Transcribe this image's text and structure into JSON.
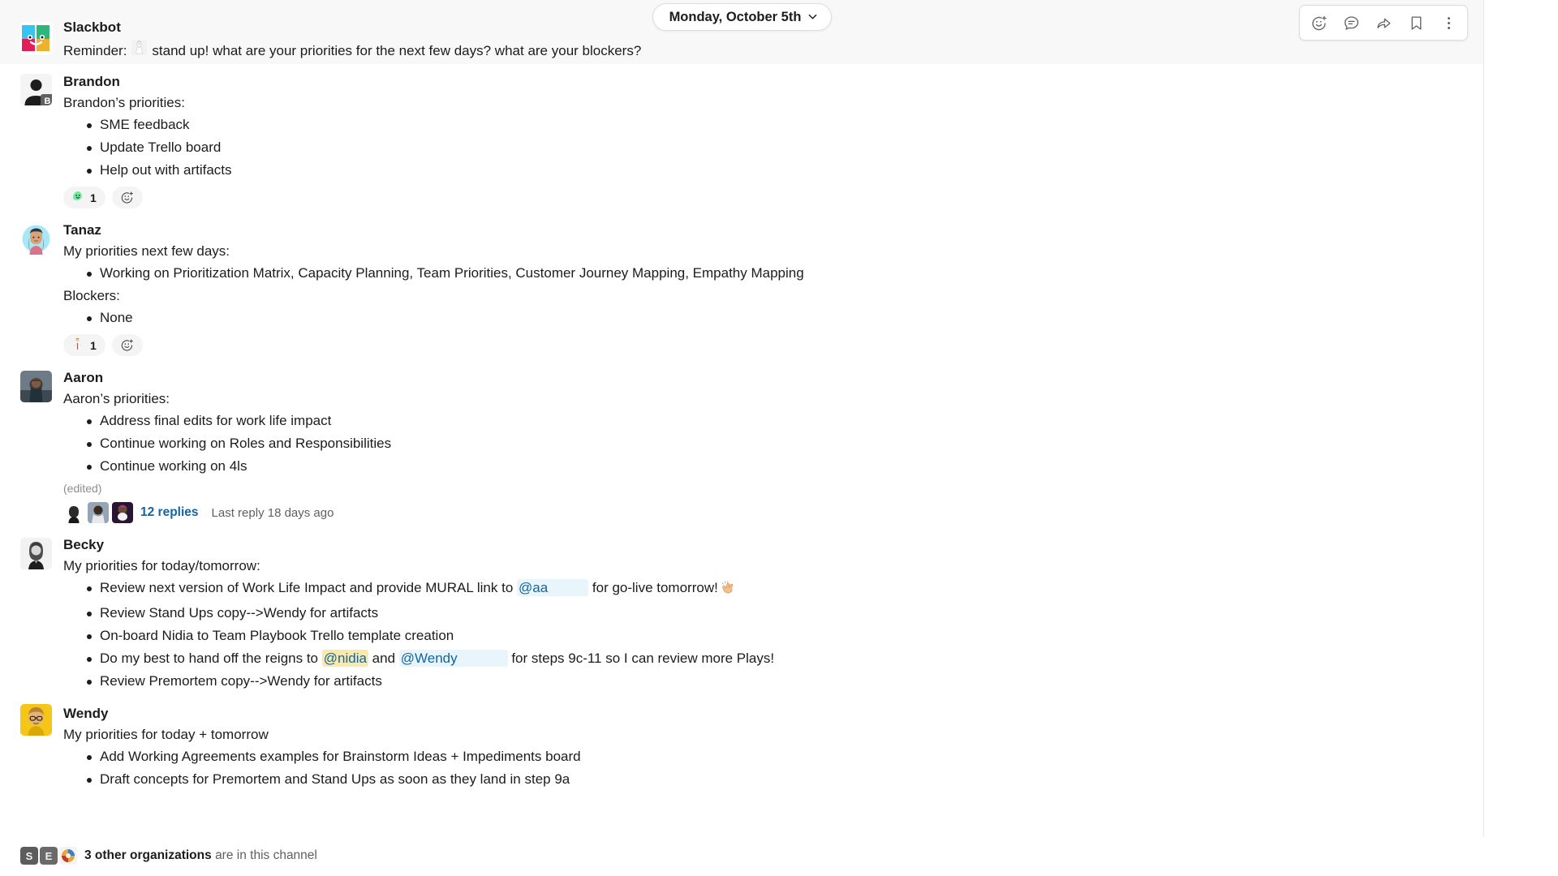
{
  "header": {
    "date_pill_label": "Monday, October 5th",
    "chevron_icon": "chevron-down-icon",
    "toolbar": {
      "add_reaction": "add-reaction-icon",
      "reply_in_thread": "reply-in-thread-icon",
      "forward": "forward-message-icon",
      "save": "bookmark-icon",
      "more": "more-actions-icon"
    }
  },
  "slackbot": {
    "name": "Slackbot",
    "reminder_prefix": "Reminder:",
    "emoji": "standing-person-emoji",
    "reminder_text": "stand up! what are your priorities for the next few days? what are your blockers?"
  },
  "messages": [
    {
      "author": "Brandon",
      "avatar_type": "default-silhouette",
      "badge": "B",
      "intro": "Brandon’s priorities:",
      "bullets": [
        "SME feedback",
        "Update Trello board",
        "Help out with artifacts"
      ],
      "reactions": [
        {
          "emoji": "green-blob-emoji",
          "count": "1"
        }
      ],
      "add_reaction_label": "add-reaction-icon"
    },
    {
      "author": "Tanaz",
      "avatar_type": "illustrated-cyan",
      "intro": "My priorities next few days:",
      "bullets": [
        "Working on Prioritization Matrix, Capacity Planning, Team Priorities, Customer Journey Mapping, Empathy Mapping"
      ],
      "second_intro": "Blockers:",
      "second_bullets": [
        "None"
      ],
      "reactions": [
        {
          "emoji": "person-emoji",
          "count": "1"
        }
      ],
      "add_reaction_label": "add-reaction-icon"
    },
    {
      "author": "Aaron",
      "avatar_type": "photo-dark",
      "intro": "Aaron’s priorities:",
      "bullets": [
        "Address final edits for work life impact",
        "Continue working on Roles and Responsibilities",
        "Continue working on 4ls"
      ],
      "edited_label": "(edited)",
      "thread": {
        "replies_label": "12 replies",
        "last_reply_label": "Last reply 18 days ago",
        "participant_count": 3
      }
    },
    {
      "author": "Becky",
      "avatar_type": "photo-bw",
      "intro": "My priorities for today/tomorrow:",
      "rich_bullets": [
        {
          "parts": [
            {
              "t": "Review next version of Work Life Impact and provide MURAL link to ",
              "k": "text"
            },
            {
              "t": "@aa",
              "k": "mention-blue"
            },
            {
              "t": " for go-live tomorrow!",
              "k": "text"
            },
            {
              "t": "clapping-hands-emoji",
              "k": "emoji"
            }
          ]
        },
        {
          "parts": [
            {
              "t": "Review Stand Ups copy-->Wendy for artifacts",
              "k": "text"
            }
          ]
        },
        {
          "parts": [
            {
              "t": "On-board Nidia to Team Playbook Trello template creation",
              "k": "text"
            }
          ]
        },
        {
          "parts": [
            {
              "t": "Do my best to hand off the reigns to ",
              "k": "text"
            },
            {
              "t": "@nidia",
              "k": "mention-yellow"
            },
            {
              "t": " and ",
              "k": "text"
            },
            {
              "t": "@Wendy",
              "k": "mention-blue-wide"
            },
            {
              "t": " for steps 9c-11 so I can review more Plays!",
              "k": "text"
            }
          ]
        },
        {
          "parts": [
            {
              "t": "Review Premortem copy-->Wendy for artifacts",
              "k": "text"
            }
          ]
        }
      ]
    },
    {
      "author": "Wendy",
      "avatar_type": "photo-yellow",
      "intro": "My priorities for today + tomorrow",
      "bullets": [
        "Add Working Agreements examples for Brainstorm Ideas + Impediments board",
        "Draft concepts for Premortem and Stand Ups as soon as they land in step 9a"
      ]
    }
  ],
  "footer": {
    "org_count_label": "3 other organizations",
    "suffix_label": "are in this channel",
    "icon_names": [
      "org-icon-1",
      "org-icon-2",
      "org-icon-3"
    ]
  },
  "colors": {
    "link": "#1264a3",
    "mention_blue_bg": "#e8f5fa",
    "mention_yellow_bg": "#fbe9aa",
    "text": "#1d1c1d",
    "muted": "#616061",
    "banner_bg": "#f8f8f8"
  }
}
